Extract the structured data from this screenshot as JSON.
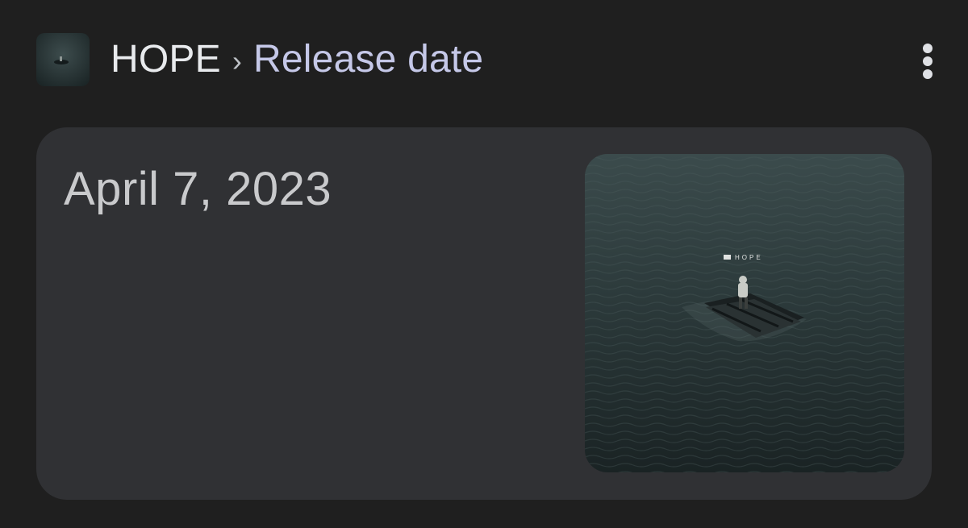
{
  "header": {
    "entity_title": "HOPE",
    "separator": "›",
    "attribute_label": "Release date",
    "menu_icon": "more-vert-icon"
  },
  "result": {
    "value": "April 7, 2023",
    "cover_text": "HOPE"
  },
  "colors": {
    "background": "#1f1f1f",
    "card": "#303134",
    "title_text": "#e8eaed",
    "attribute_text": "#c5c8e8",
    "value_text": "#c9cacc",
    "sea_dark": "#1b2526",
    "sea_light": "#3a4a4b"
  }
}
